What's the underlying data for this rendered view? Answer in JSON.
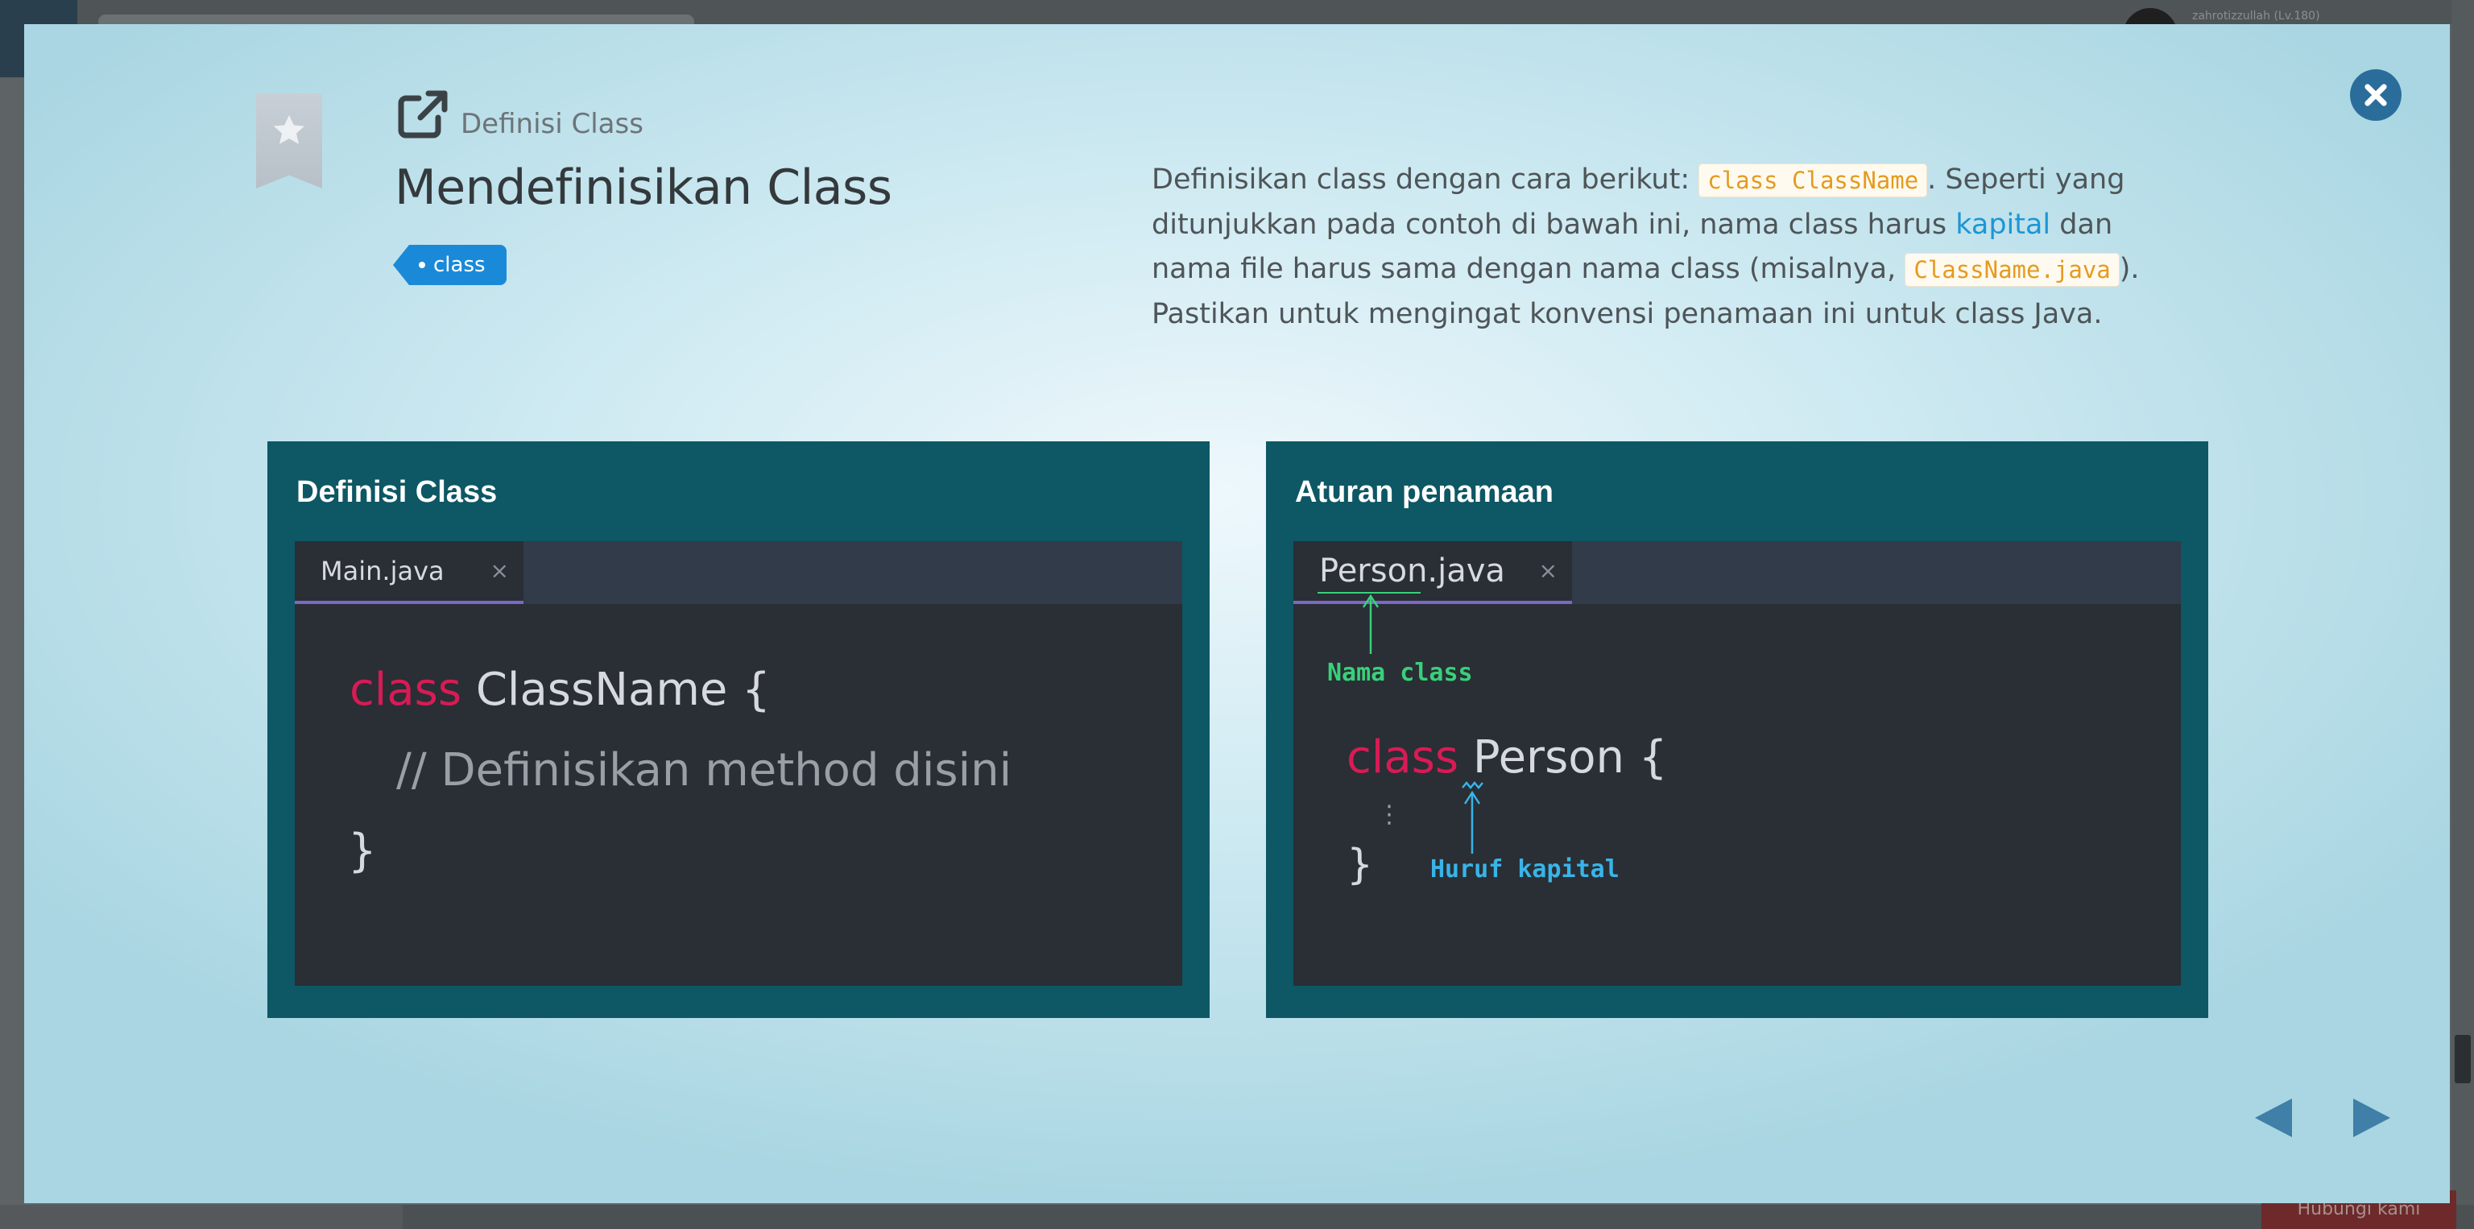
{
  "background": {
    "username": "zahrotizzullah (Lv.180)",
    "bottom_button": "Hubungi kami"
  },
  "modal": {
    "category": "Definisi Class",
    "title": "Mendefinisikan Class",
    "tag": "class",
    "description": {
      "part1": "Definisikan class dengan cara berikut: ",
      "code1": "class ClassName",
      "part2": ". Seperti yang ditunjukkan pada contoh di bawah ini, nama class harus ",
      "link": "kapital",
      "part3": " dan nama file harus sama dengan nama class (misalnya, ",
      "code2": "ClassName.java",
      "part4": "). Pastikan untuk mengingat konvensi penamaan ini untuk class Java."
    },
    "slides": [
      {
        "title": "Definisi Class",
        "tab": "Main.java",
        "tab_close": "×",
        "keyword": "class",
        "class_rest": " ClassName {",
        "comment": "// Definisikan method disini",
        "closing": "}"
      },
      {
        "title": "Aturan penamaan",
        "tab": "Person.java",
        "tab_close": "×",
        "annotation_file": "Nama class",
        "keyword": "class",
        "class_rest": " Person {",
        "dots": "⋮",
        "closing": "}",
        "annotation_capital": "Huruf kapital"
      }
    ]
  },
  "colors": {
    "tag": "#1a8ad8",
    "keyword": "#d81b55",
    "annotation_green": "#39d07a",
    "annotation_blue": "#38b4e8",
    "slide_bg": "#0e5765"
  },
  "icons": [
    "star-icon",
    "external-link-icon",
    "close-icon",
    "arrow-left-icon",
    "arrow-right-icon"
  ]
}
